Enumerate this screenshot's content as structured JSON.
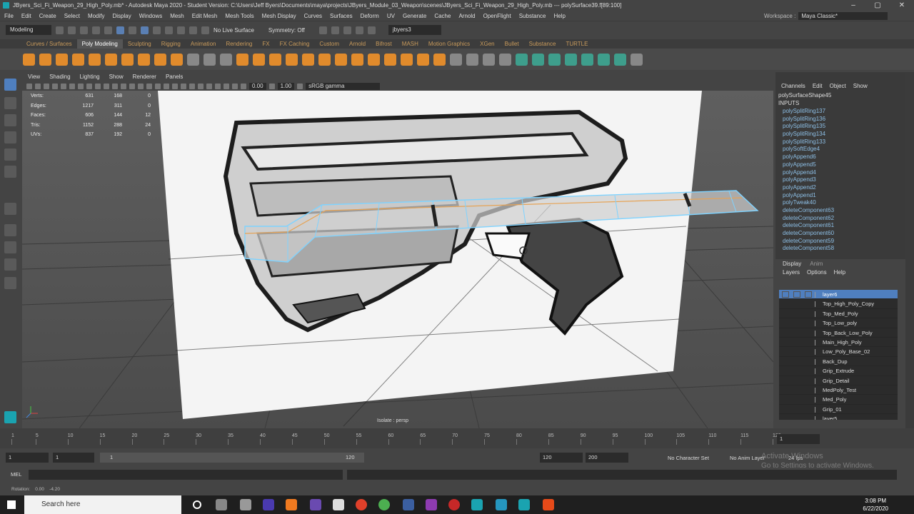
{
  "title": "JByers_Sci_Fi_Weapon_29_High_Poly.mb* - Autodesk Maya 2020 - Student Version: C:\\Users\\Jeff Byers\\Documents\\maya\\projects\\JByers_Module_03_Weapon\\scenes\\JByers_Sci_Fi_Weapon_29_High_Poly.mb   ---   polySurface39.f[89:100]",
  "menu": [
    "File",
    "Edit",
    "Create",
    "Select",
    "Modify",
    "Display",
    "Windows",
    "Mesh",
    "Edit Mesh",
    "Mesh Tools",
    "Mesh Display",
    "Curves",
    "Surfaces",
    "Deform",
    "UV",
    "Generate",
    "Cache",
    "Arnold",
    "OpenFlight",
    "Substance",
    "Help"
  ],
  "workspace": {
    "label": "Workspace :",
    "value": "Maya Classic*"
  },
  "statusline": {
    "mode": "Modeling",
    "live": "No Live Surface",
    "symmetry": "Symmetry: Off",
    "user": "jbyers3"
  },
  "shelf_tabs": [
    "Curves / Surfaces",
    "Poly Modeling",
    "Sculpting",
    "Rigging",
    "Animation",
    "Rendering",
    "FX",
    "FX Caching",
    "Custom",
    "Arnold",
    "Bifrost",
    "MASH",
    "Motion Graphics",
    "XGen",
    "Bullet",
    "Substance",
    "TURTLE"
  ],
  "active_shelf_tab": "Poly Modeling",
  "viewport_menu": [
    "View",
    "Shading",
    "Lighting",
    "Show",
    "Renderer",
    "Panels"
  ],
  "viewport_toolbar": {
    "val1": "0.00",
    "val2": "1.00",
    "colorspace": "sRGB gamma"
  },
  "hud": [
    {
      "label": "Verts:",
      "a": "631",
      "b": "168",
      "c": "0"
    },
    {
      "label": "Edges:",
      "a": "1217",
      "b": "311",
      "c": "0"
    },
    {
      "label": "Faces:",
      "a": "606",
      "b": "144",
      "c": "12"
    },
    {
      "label": "Tris:",
      "a": "1152",
      "b": "288",
      "c": "24"
    },
    {
      "label": "UVs:",
      "a": "837",
      "b": "192",
      "c": "0"
    }
  ],
  "isolate": "Isolate : persp",
  "channelbox": {
    "menu": [
      "Channels",
      "Edit",
      "Object",
      "Show"
    ],
    "shape": "polySurfaceShape45",
    "inputs": "INPUTS",
    "items": [
      "polySplitRing137",
      "polySplitRing136",
      "polySplitRing135",
      "polySplitRing134",
      "polySplitRing133",
      "polySoftEdge4",
      "polyAppend6",
      "polyAppend5",
      "polyAppend4",
      "polyAppend3",
      "polyAppend2",
      "polyAppend1",
      "polyTweak40",
      "deleteComponent63",
      "deleteComponent62",
      "deleteComponent61",
      "deleteComponent60",
      "deleteComponent59",
      "deleteComponent58"
    ]
  },
  "layer_tabs": [
    "Display",
    "Anim"
  ],
  "layer_menu": [
    "Layers",
    "Options",
    "Help"
  ],
  "layers": [
    "layer6",
    "Top_High_Poly_Copy",
    "Top_Med_Poly",
    "Top_Low_poly",
    "Top_Back_Low_Poly",
    "Main_High_Poly",
    "Low_Poly_Base_02",
    "Back_Dup",
    "Grip_Extrude",
    "Grip_Detail",
    "MedPoly_Test",
    "Med_Poly",
    "Grip_01",
    "layer5"
  ],
  "timeline_ticks": [
    "1",
    "5",
    "10",
    "15",
    "20",
    "25",
    "30",
    "35",
    "40",
    "45",
    "50",
    "55",
    "60",
    "65",
    "70",
    "75",
    "80",
    "85",
    "90",
    "95",
    "100",
    "105",
    "110",
    "115",
    "120"
  ],
  "current_frame": "1",
  "range": {
    "start": "1",
    "inner_start": "1",
    "slider_start": "1",
    "slider_end": "120",
    "end": "120",
    "max": "200",
    "no_char": "No Character Set",
    "no_anim": "No Anim Layer",
    "fps": "24 fps"
  },
  "mel": "MEL",
  "rotation": {
    "label": "Rotation:",
    "x": "0.00",
    "y": "-4.20"
  },
  "activate": {
    "line1": "Activate Windows",
    "line2": "Go to Settings to activate Windows."
  },
  "taskbar": {
    "search": "Search here",
    "time": "3:08 PM",
    "date": "6/22/2020"
  },
  "side_tabs": [
    "Channel Box / Layer Editor",
    "Modeling Toolkit",
    "Attribute Editor",
    "Tool Settings"
  ]
}
